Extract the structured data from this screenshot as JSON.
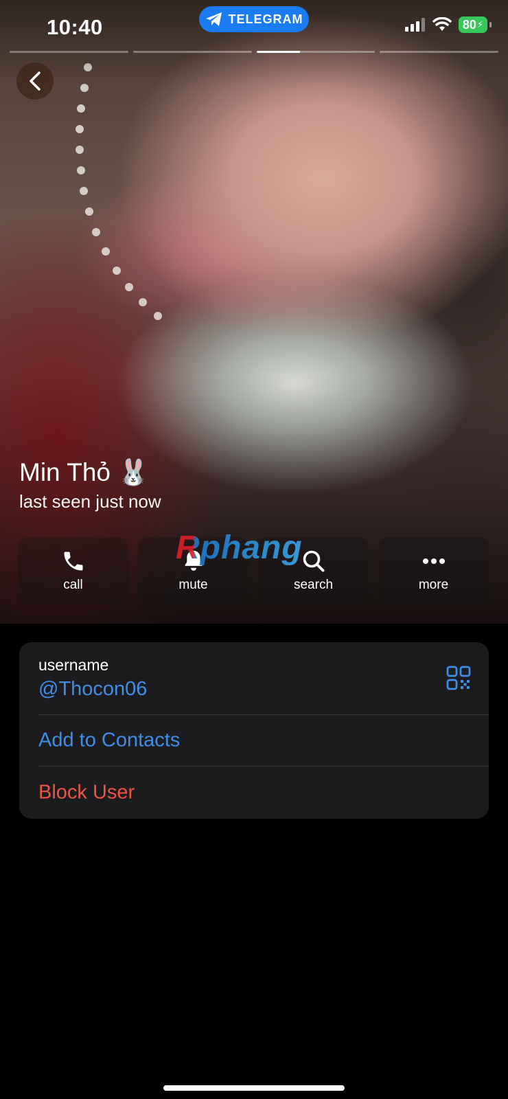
{
  "status_bar": {
    "time": "10:40",
    "app_label": "TELEGRAM",
    "battery": "80"
  },
  "story": {
    "segments": 4,
    "active_index": 2,
    "active_progress": 0.37
  },
  "profile": {
    "name": "Min Thỏ 🐰",
    "status": "last seen just now"
  },
  "actions": [
    {
      "label": "call",
      "icon": "phone-icon"
    },
    {
      "label": "mute",
      "icon": "bell-icon"
    },
    {
      "label": "search",
      "icon": "search-icon"
    },
    {
      "label": "more",
      "icon": "more-dots-icon"
    }
  ],
  "watermark": "Rphang",
  "info": {
    "username_label": "username",
    "username_value": "@Thocon06",
    "add_contact": "Add to Contacts",
    "block_user": "Block User"
  },
  "colors": {
    "accent": "#3e8ee8",
    "danger": "#eb5545",
    "telegram": "#1a7cf3",
    "battery": "#35c759"
  }
}
